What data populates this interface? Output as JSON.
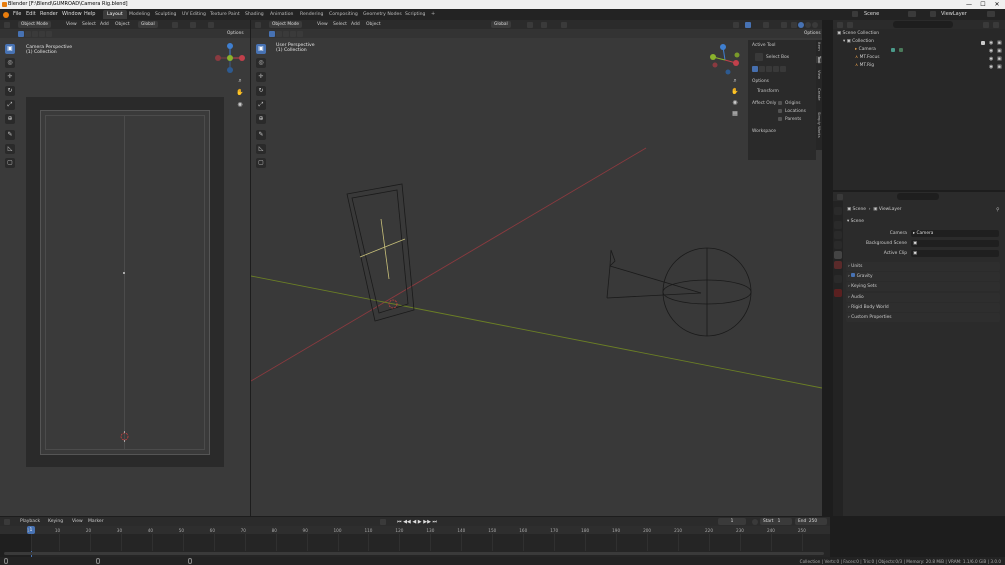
{
  "window": {
    "title": "Blender [F:\\Blend\\GUMROAD\\Camera Rig.blend]",
    "min": "—",
    "max": "☐",
    "close": "✕"
  },
  "menu": {
    "items": [
      "File",
      "Edit",
      "Render",
      "Window",
      "Help"
    ],
    "workspaces": [
      "Layout",
      "Modeling",
      "Sculpting",
      "UV Editing",
      "Texture Paint",
      "Shading",
      "Animation",
      "Rendering",
      "Compositing",
      "Geometry Nodes",
      "Scripting"
    ],
    "add_tab": "+",
    "scene_label": "Scene",
    "viewlayer_label": "ViewLayer"
  },
  "left_viewport": {
    "mode": "Object Mode",
    "menus": [
      "View",
      "Select",
      "Add",
      "Object"
    ],
    "orientation": "Global",
    "options": "Options",
    "label_line1": "Camera Perspective",
    "label_line2": "(1) Collection"
  },
  "main_viewport": {
    "mode": "Object Mode",
    "menus": [
      "View",
      "Select",
      "Add",
      "Object"
    ],
    "orientation": "Global",
    "options": "Options",
    "label_line1": "User Perspective",
    "label_line2": "(1) Collection"
  },
  "npanel": {
    "active_tool_header": "Active Tool",
    "select_box": "Select Box",
    "options_header": "Options",
    "transform_header": "Transform",
    "affect_only": "Affect Only",
    "origins": "Origins",
    "locations": "Locations",
    "parents": "Parents",
    "workspace": "Workspace",
    "tabs": [
      "Item",
      "Tool",
      "View",
      "Create",
      "Simply Works"
    ]
  },
  "outliner": {
    "scene_collection": "Scene Collection",
    "collection": "Collection",
    "items": [
      "Camera",
      "MT.Focus",
      "MT.Rig"
    ]
  },
  "properties": {
    "breadcrumb_scene": "Scene",
    "breadcrumb_viewlayer": "ViewLayer",
    "scene_header": "Scene",
    "camera_label": "Camera",
    "camera_value": "Camera",
    "bg_scene_label": "Background Scene",
    "active_clip_label": "Active Clip",
    "sections": [
      "Units",
      "Gravity",
      "Keying Sets",
      "Audio",
      "Rigid Body World",
      "Custom Properties"
    ]
  },
  "timeline": {
    "menus": [
      "Playback",
      "Keying",
      "View",
      "Marker"
    ],
    "current_frame": "1",
    "start_label": "Start",
    "start": "1",
    "end_label": "End",
    "end": "250",
    "ticks": [
      "1",
      "10",
      "20",
      "30",
      "40",
      "50",
      "60",
      "70",
      "80",
      "90",
      "100",
      "110",
      "120",
      "130",
      "140",
      "150",
      "160",
      "170",
      "180",
      "190",
      "200",
      "210",
      "220",
      "230",
      "240",
      "250"
    ]
  },
  "status": {
    "text": "Collection | Verts:0 | Faces:0 | Tris:0 | Objects:0/3 | Memory: 20.8 MiB | VRAM: 1.1/6.0 GiB | 3.0.0"
  },
  "colors": {
    "accent": "#4772b3",
    "x_axis": "#c2404b",
    "y_axis": "#8bb32c",
    "z_axis": "#3f7fd0"
  }
}
